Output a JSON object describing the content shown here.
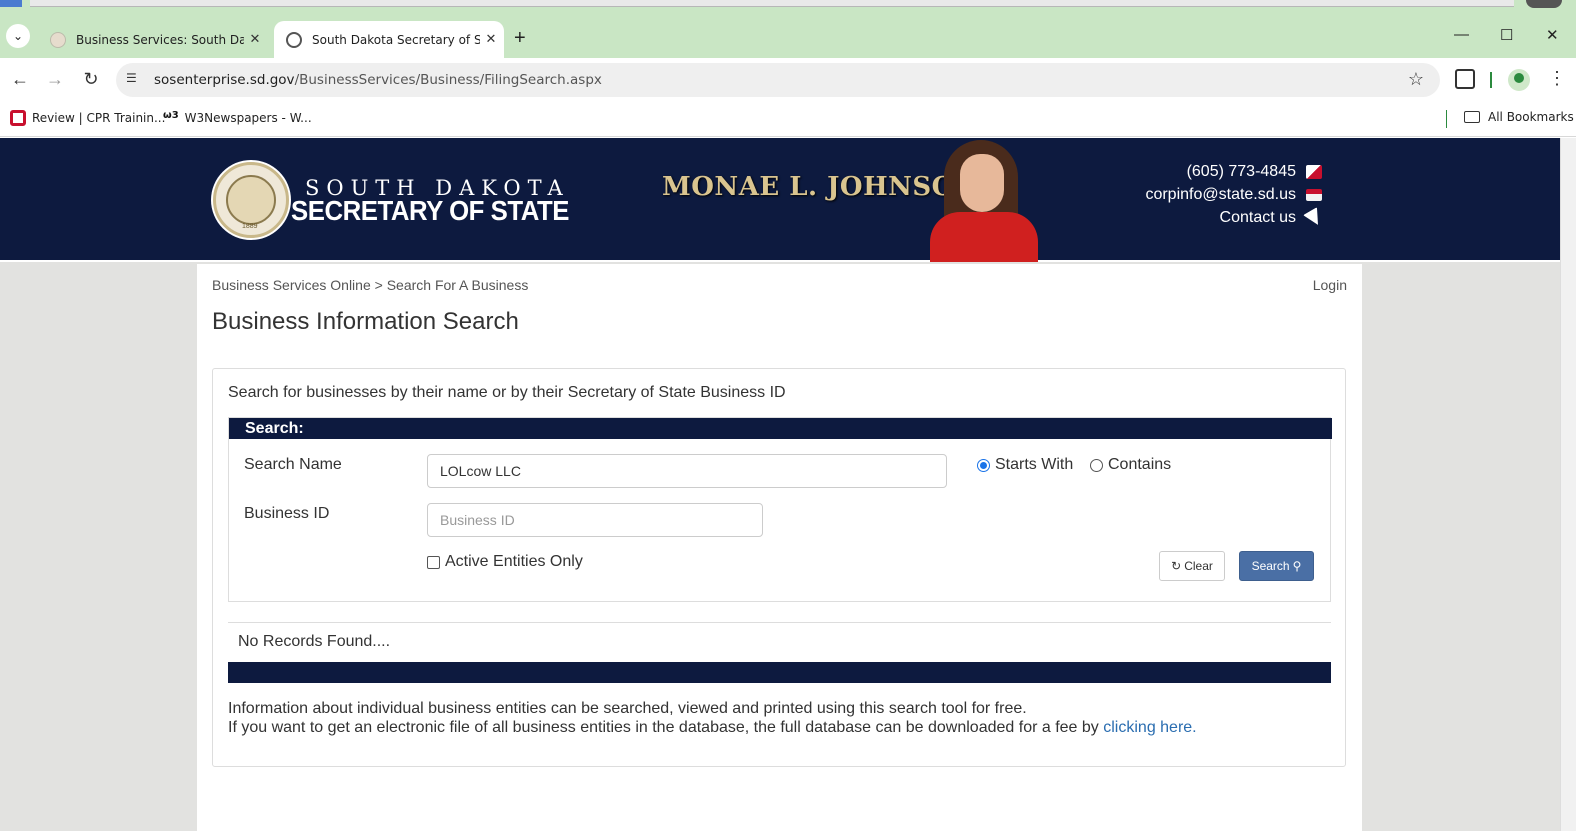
{
  "browser": {
    "tabs": [
      {
        "title": "Business Services: South Dakota",
        "active": false
      },
      {
        "title": "South Dakota Secretary of State",
        "active": true
      }
    ],
    "url_host": "sosenterprise.sd.gov",
    "url_path": "/BusinessServices/Business/FilingSearch.aspx",
    "bookmarks": [
      "Review | CPR Trainin...",
      "W3Newspapers - W..."
    ],
    "all_bookmarks": "All Bookmarks",
    "w3_icon_text": "ω3"
  },
  "header": {
    "sos_line1": "SOUTH DAKOTA",
    "sos_line2": "SECRETARY OF STATE",
    "official_name": "MONAE L. JOHNSON",
    "seal_year": "1889",
    "phone": "(605) 773-4845",
    "email": "corpinfo@state.sd.us",
    "contact": "Contact us",
    "navy": "#0d1a3f",
    "gold": "#d9c48f"
  },
  "page": {
    "breadcrumb": "Business Services Online > Search For A Business",
    "login": "Login",
    "title": "Business Information Search",
    "intro": "Search for businesses by their name or by their Secretary of State Business ID",
    "search_header": "Search:",
    "search_name_label": "Search Name",
    "search_name_value": "LOLcow LLC",
    "business_id_label": "Business ID",
    "business_id_placeholder": "Business ID",
    "radio_starts_with": "Starts With",
    "radio_contains": "Contains",
    "selected_match": "Starts With",
    "active_only_label": "Active Entities Only",
    "active_only_checked": false,
    "clear_button": "Clear",
    "search_button": "Search",
    "no_records": "No Records Found....",
    "info_line1": "Information about individual business entities can be searched, viewed and printed using this search tool for free.",
    "info_line2": "If you want to get an electronic file of all business entities in the database, the full database can be downloaded for a fee by",
    "info_link": "clicking here."
  }
}
